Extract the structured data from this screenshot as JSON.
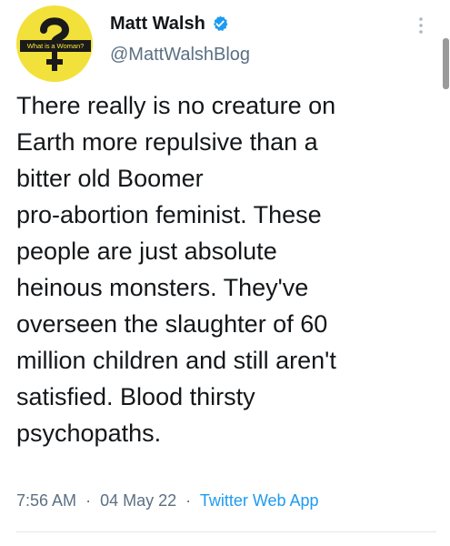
{
  "author": {
    "display_name": "Matt Walsh",
    "handle": "@MattWalshBlog",
    "verified": true,
    "avatar": {
      "caption": "What is a Woman?",
      "background": "#f3e13b",
      "icon": "female-symbol-question-icon"
    }
  },
  "tweet": {
    "lines": [
      "There really is no creature on",
      "Earth more repulsive than a",
      "bitter old Boomer",
      "pro-abortion feminist. These",
      "people are just absolute",
      "heinous monsters. They've",
      "overseen the slaughter of 60",
      "million children and still aren't",
      "satisfied. Blood thirsty",
      "psychopaths."
    ]
  },
  "meta": {
    "time": "7:56 AM",
    "separator": "·",
    "date": "04 May 22",
    "source": "Twitter Web App"
  },
  "colors": {
    "verified_badge": "#1d9bf0",
    "source_link": "#1d9bf0",
    "secondary_text": "#5b7083"
  }
}
